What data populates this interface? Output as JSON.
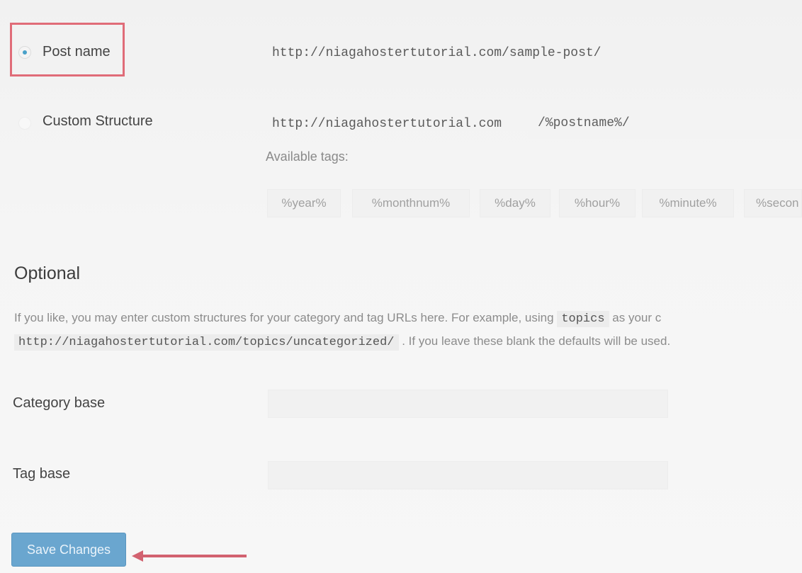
{
  "permalink_options": {
    "post_name": {
      "label": "Post name",
      "example": "http://niagahostertutorial.com/sample-post/",
      "checked": true
    },
    "custom_structure": {
      "label": "Custom Structure",
      "base_url": "http://niagahostertutorial.com",
      "value": "/%postname%/",
      "checked": false
    },
    "available_tags_label": "Available tags:",
    "tags": [
      "%year%",
      "%monthnum%",
      "%day%",
      "%hour%",
      "%minute%",
      "%secon"
    ]
  },
  "optional": {
    "title": "Optional",
    "description_part1": "If you like, you may enter custom structures for your category and tag URLs here. For example, using",
    "description_code": "topics",
    "description_part2": "as your c",
    "description_url": "http://niagahostertutorial.com/topics/uncategorized/",
    "description_part3": ". If you leave these blank the defaults will be used.",
    "category_base_label": "Category base",
    "category_base_value": "",
    "tag_base_label": "Tag base",
    "tag_base_value": ""
  },
  "save_button_label": "Save Changes",
  "colors": {
    "highlight": "#e06c78",
    "button": "#6aa6cf",
    "arrow": "#d26270"
  }
}
